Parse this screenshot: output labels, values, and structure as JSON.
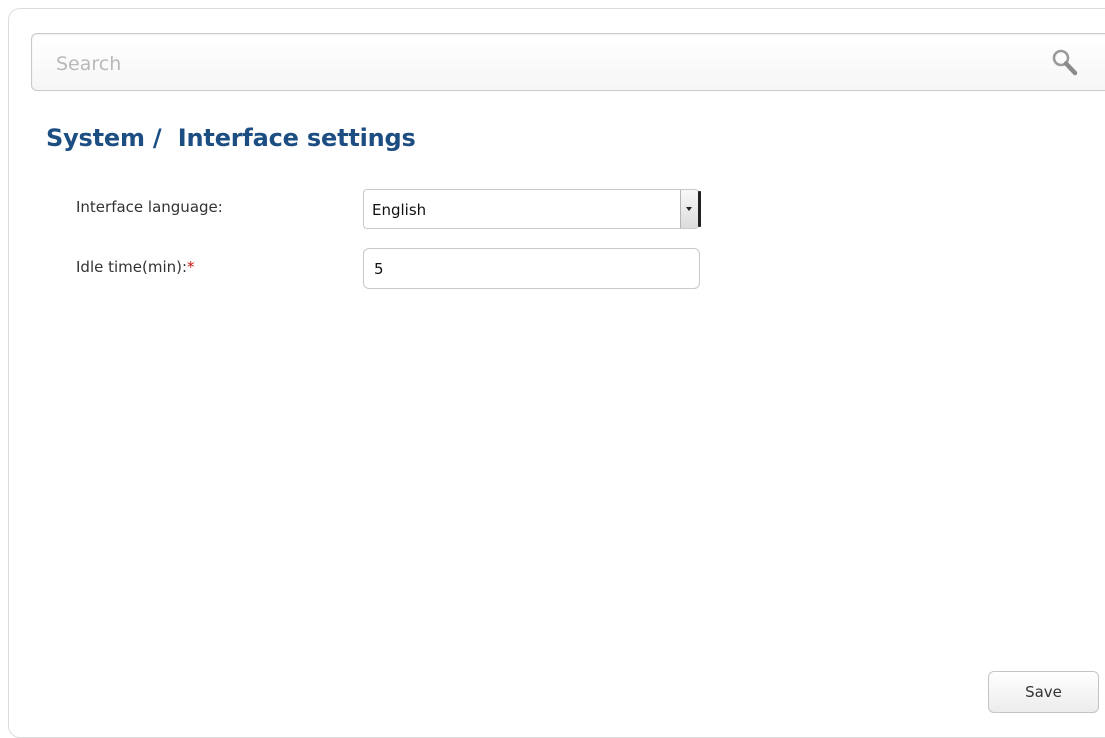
{
  "search": {
    "placeholder": "Search",
    "value": "",
    "icon": "search-icon"
  },
  "page": {
    "title": "System /  Interface settings"
  },
  "form": {
    "language": {
      "label": "Interface language:",
      "selected": "English"
    },
    "idle_time": {
      "label": "Idle time(min):",
      "required_marker": "*",
      "value": "5"
    }
  },
  "actions": {
    "save_label": "Save"
  },
  "colors": {
    "title": "#1d4e82",
    "required": "#d01010"
  }
}
